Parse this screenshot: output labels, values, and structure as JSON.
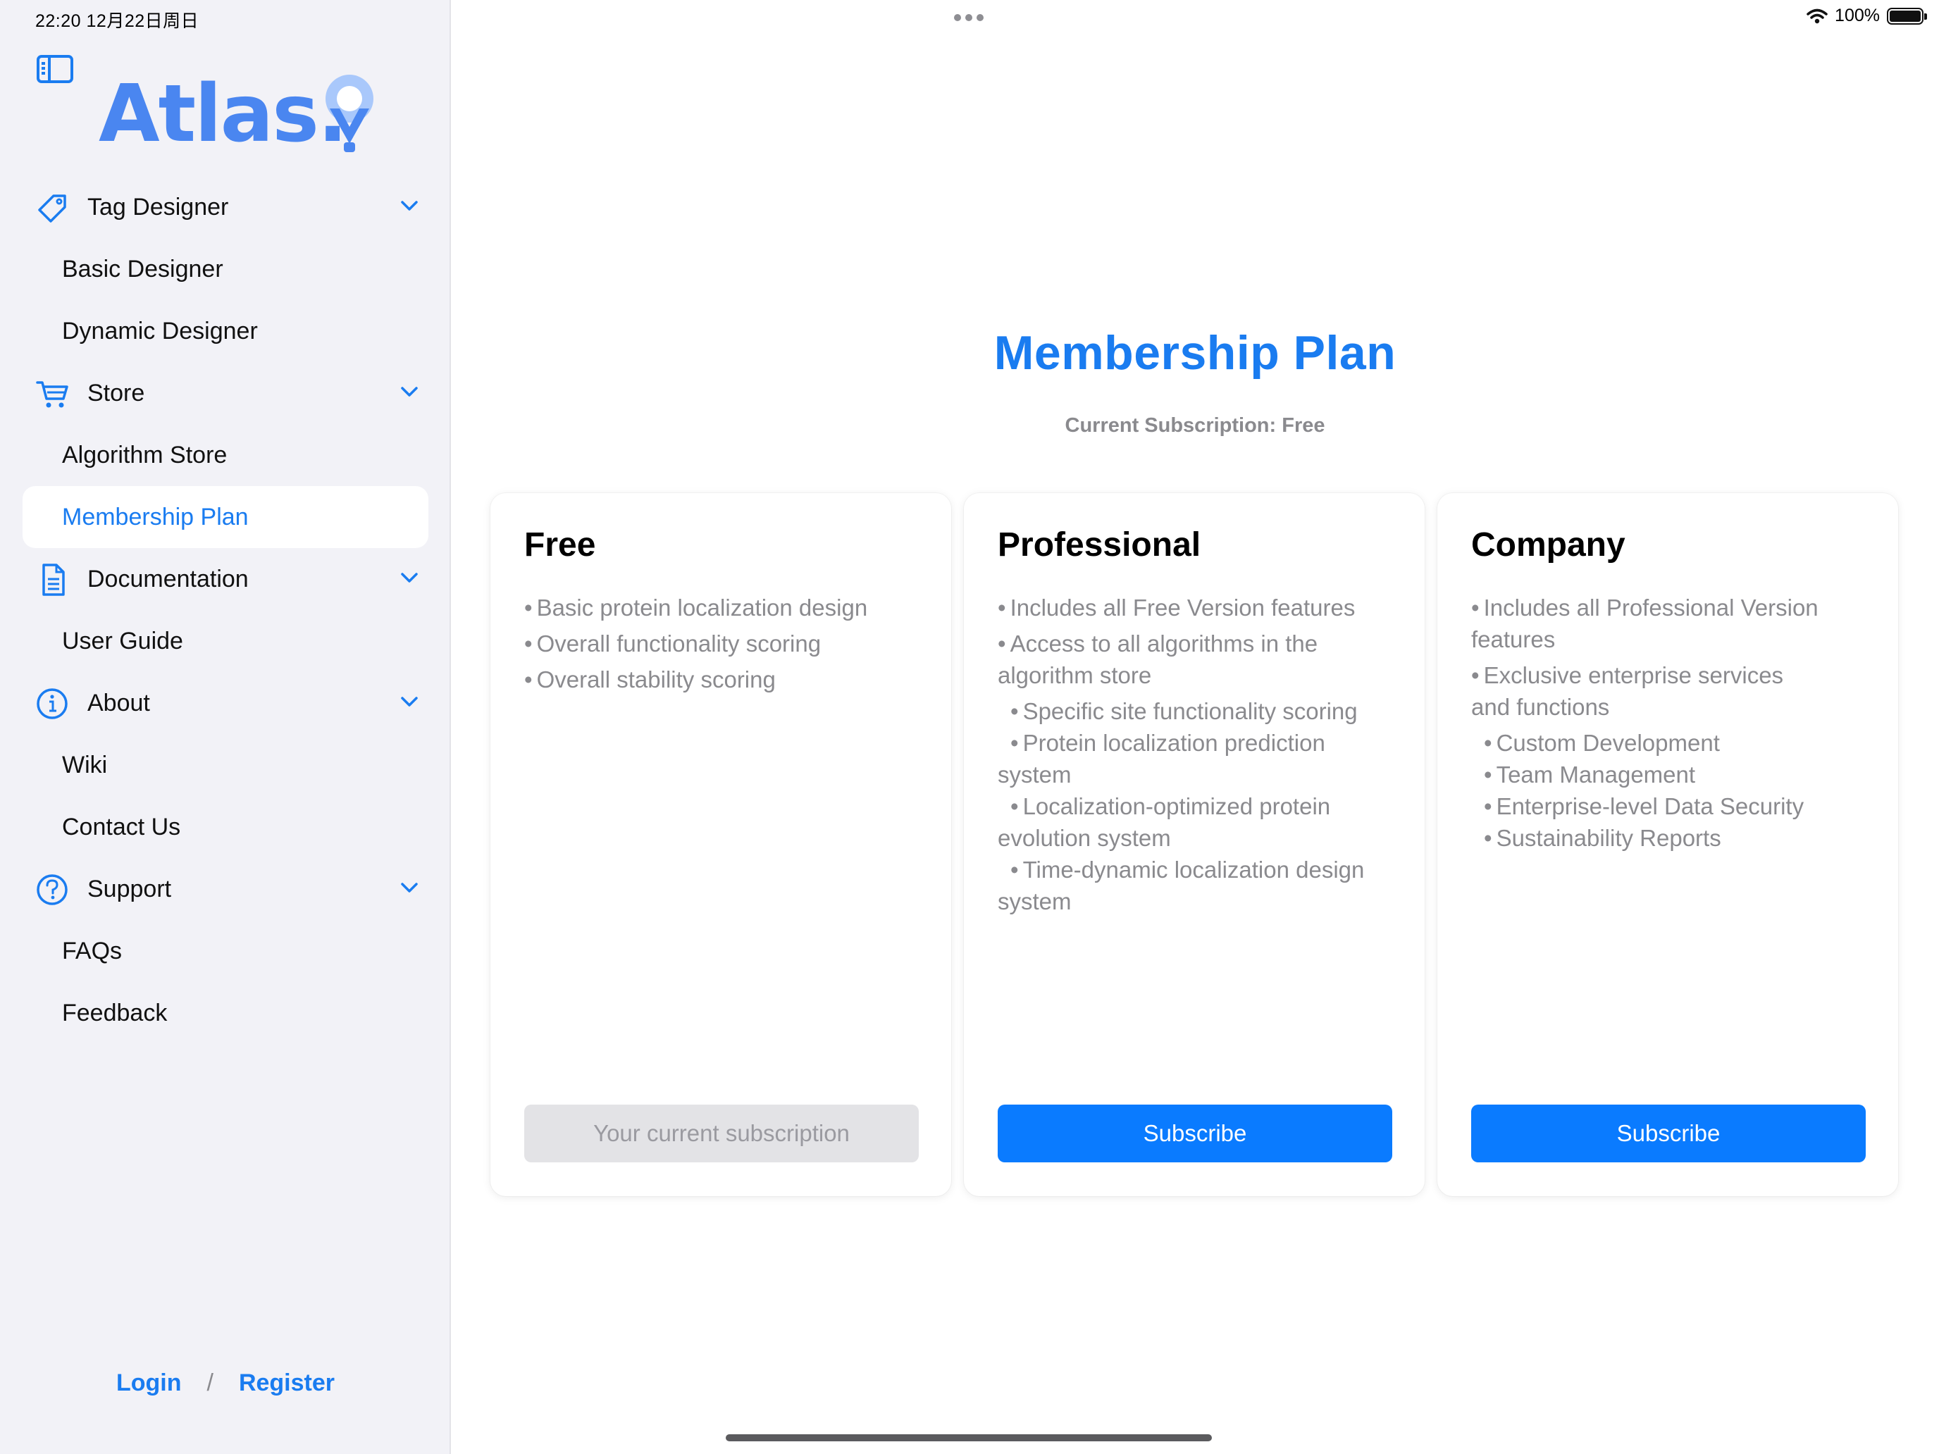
{
  "status_bar": {
    "time": "22:20   12月22日周日",
    "battery": "100%"
  },
  "logo_text": "Atlas.",
  "sidebar": {
    "sections": [
      {
        "label": "Tag Designer",
        "icon": "tag-icon",
        "items": [
          "Basic Designer",
          "Dynamic Designer"
        ]
      },
      {
        "label": "Store",
        "icon": "cart-icon",
        "items": [
          "Algorithm Store",
          "Membership Plan"
        ]
      },
      {
        "label": "Documentation",
        "icon": "document-icon",
        "items": [
          "User Guide"
        ]
      },
      {
        "label": "About",
        "icon": "info-icon",
        "items": [
          "Wiki",
          "Contact Us"
        ]
      },
      {
        "label": "Support",
        "icon": "question-icon",
        "items": [
          "FAQs",
          "Feedback"
        ]
      }
    ],
    "active_item": "Membership Plan",
    "login": "Login",
    "separator": "/",
    "register": "Register"
  },
  "main": {
    "title": "Membership Plan",
    "subtitle": "Current Subscription: Free",
    "plans": [
      {
        "name": "Free",
        "features": [
          {
            "text": "Basic protein localization design",
            "level": 0
          },
          {
            "text": "Overall functionality scoring",
            "level": 0
          },
          {
            "text": "Overall stability scoring",
            "level": 0
          }
        ],
        "button": "Your current subscription",
        "button_enabled": false
      },
      {
        "name": "Professional",
        "features": [
          {
            "text": "Includes all Free Version features",
            "level": 0
          },
          {
            "text": "Access to all algorithms in the algorithm store",
            "level": 0
          },
          {
            "text": "Specific site functionality scoring",
            "level": 1
          },
          {
            "text": "Protein localization prediction system",
            "level": 1
          },
          {
            "text": "Localization-optimized protein evolution system",
            "level": 1
          },
          {
            "text": "Time-dynamic localization design system",
            "level": 1
          }
        ],
        "button": "Subscribe",
        "button_enabled": true
      },
      {
        "name": "Company",
        "features": [
          {
            "text": "Includes all Professional Version features",
            "level": 0
          },
          {
            "text": "Exclusive enterprise services and functions",
            "level": 0
          },
          {
            "text": "Custom Development",
            "level": 1
          },
          {
            "text": "Team Management",
            "level": 1
          },
          {
            "text": "Enterprise-level Data Security",
            "level": 1
          },
          {
            "text": "Sustainability Reports",
            "level": 1
          }
        ],
        "button": "Subscribe",
        "button_enabled": true
      }
    ]
  },
  "colors": {
    "accent": "#1a7cf0",
    "button_primary": "#0a7bff",
    "muted_text": "#8a8a8e",
    "sidebar_bg": "#f2f2f7"
  }
}
